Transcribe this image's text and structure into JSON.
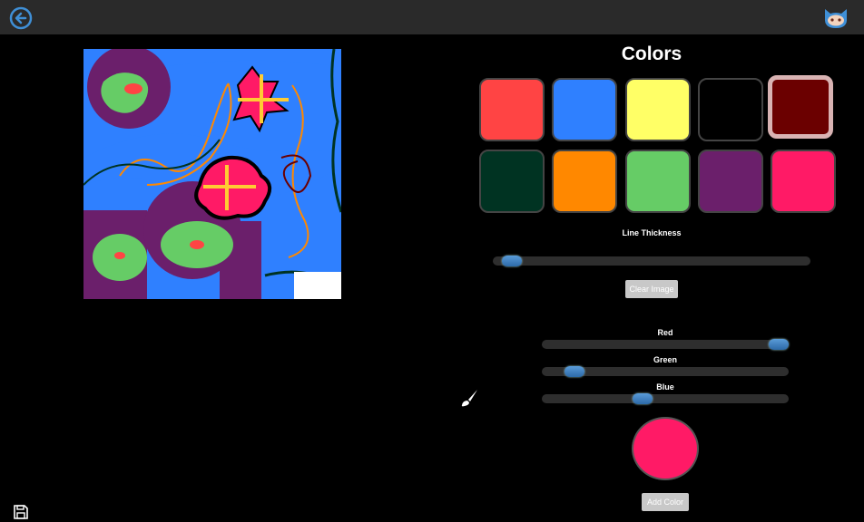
{
  "colors": {
    "title": "Colors",
    "swatches": [
      {
        "color": "#ff4444",
        "selected": false
      },
      {
        "color": "#2f80ff",
        "selected": false
      },
      {
        "color": "#ffff66",
        "selected": false
      },
      {
        "color": "#000000",
        "selected": false
      },
      {
        "color": "#6b0000",
        "selected": true
      },
      {
        "color": "#003322",
        "selected": false
      },
      {
        "color": "#ff8800",
        "selected": false
      },
      {
        "color": "#66cc66",
        "selected": false
      },
      {
        "color": "#6b1f6b",
        "selected": false
      },
      {
        "color": "#ff1a66",
        "selected": false
      }
    ]
  },
  "line_thickness": {
    "label": "Line Thickness",
    "value": 0.03
  },
  "clear_button": "Clear Image",
  "sliders": {
    "red": {
      "label": "Red",
      "value": 1.0
    },
    "green": {
      "label": "Green",
      "value": 0.1
    },
    "blue": {
      "label": "Blue",
      "value": 0.4
    }
  },
  "preview_color": "#ff1a66",
  "add_color_button": "Add Color",
  "icons": {
    "back": "back-arrow-icon",
    "github": "github-octocat-icon",
    "brush": "paintbrush-icon",
    "save": "floppy-disk-icon"
  }
}
